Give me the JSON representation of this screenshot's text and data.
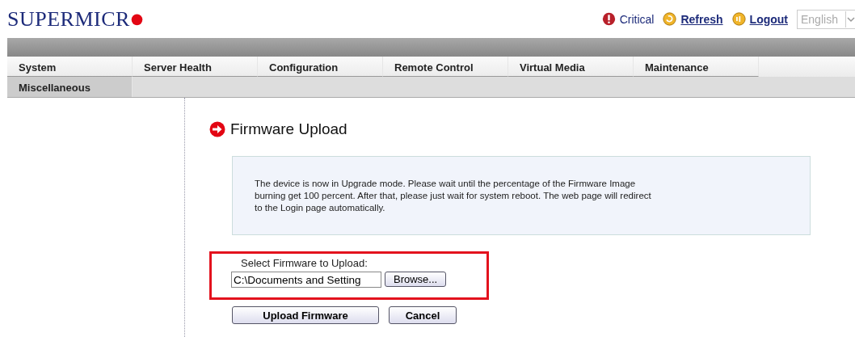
{
  "header": {
    "logo": "SUPERMICR",
    "status": "Critical",
    "links": [
      "Refresh",
      "Logout"
    ],
    "language": {
      "value": "English",
      "disabled": true
    }
  },
  "menu": [
    [
      "System",
      "Server Health",
      "Configuration",
      "Remote Control",
      "Virtual Media",
      "Maintenance"
    ],
    [
      "Miscellaneous"
    ]
  ],
  "page": {
    "title": "Firmware Upload",
    "notice": "The device is now in Upgrade mode. Please wait until the percentage of the Firmware Image burning get 100 percent. After that, please just wait for system reboot. The web page will redirect to the Login page automatically.",
    "file_label": "Select Firmware to Upload:",
    "file_value": "C:\\Documents and Setting",
    "browse": "Browse...",
    "buttons": [
      "Upload Firmware",
      "Cancel"
    ]
  }
}
